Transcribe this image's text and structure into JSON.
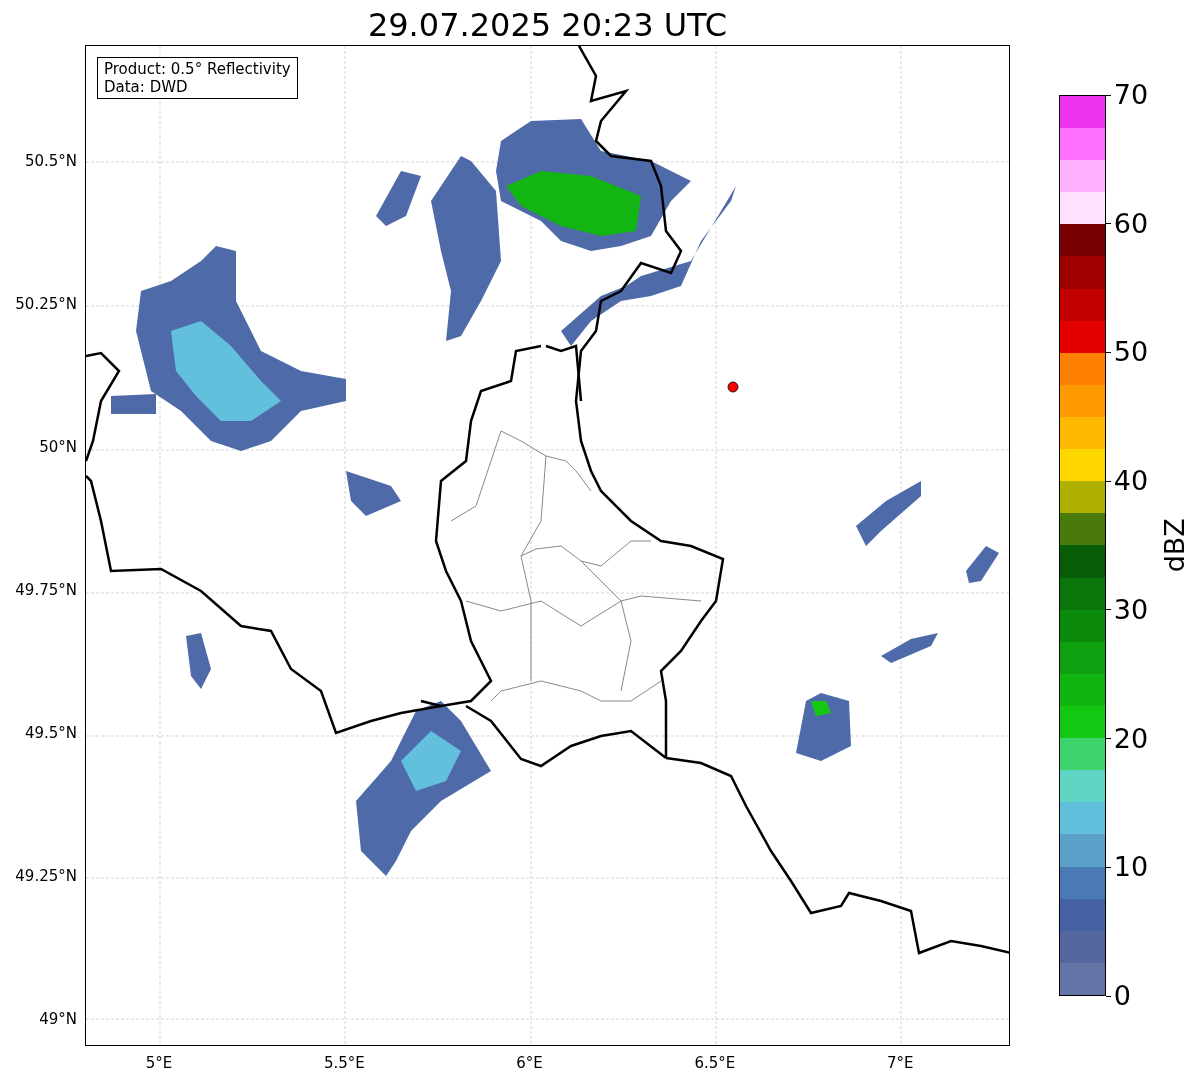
{
  "title": "29.07.2025 20:23 UTC",
  "map": {
    "legend": [
      "Product: 0.5° Reflectivity",
      "Data: DWD"
    ],
    "lat_ticks": [
      "50.5°N",
      "50.25°N",
      "50°N",
      "49.75°N",
      "49.5°N",
      "49.25°N",
      "49°N"
    ],
    "lon_ticks": [
      "5°E",
      "5.5°E",
      "6°E",
      "6.5°E",
      "7°E"
    ]
  },
  "colorbar": {
    "label": "dBZ",
    "ticks": [
      "70",
      "60",
      "50",
      "40",
      "30",
      "20",
      "10",
      "0"
    ],
    "bands": [
      {
        "color": "#6474a6"
      },
      {
        "color": "#53669e"
      },
      {
        "color": "#4560a4"
      },
      {
        "color": "#4a7ab4"
      },
      {
        "color": "#5aa0c8"
      },
      {
        "color": "#62c0dc"
      },
      {
        "color": "#5fd6c4"
      },
      {
        "color": "#3dd46e"
      },
      {
        "color": "#12c812"
      },
      {
        "color": "#10b510"
      },
      {
        "color": "#0fa00f"
      },
      {
        "color": "#0c8a0c"
      },
      {
        "color": "#0a760a"
      },
      {
        "color": "#085e08"
      },
      {
        "color": "#4a7a0a"
      },
      {
        "color": "#b0b000"
      },
      {
        "color": "#ffd700"
      },
      {
        "color": "#ffb800"
      },
      {
        "color": "#ff9900"
      },
      {
        "color": "#ff7f00"
      },
      {
        "color": "#e40000"
      },
      {
        "color": "#c20000"
      },
      {
        "color": "#a00000"
      },
      {
        "color": "#780000"
      },
      {
        "color": "#ffe0ff"
      },
      {
        "color": "#ffb0ff"
      },
      {
        "color": "#ff70ff"
      },
      {
        "color": "#ee33ee"
      }
    ]
  }
}
